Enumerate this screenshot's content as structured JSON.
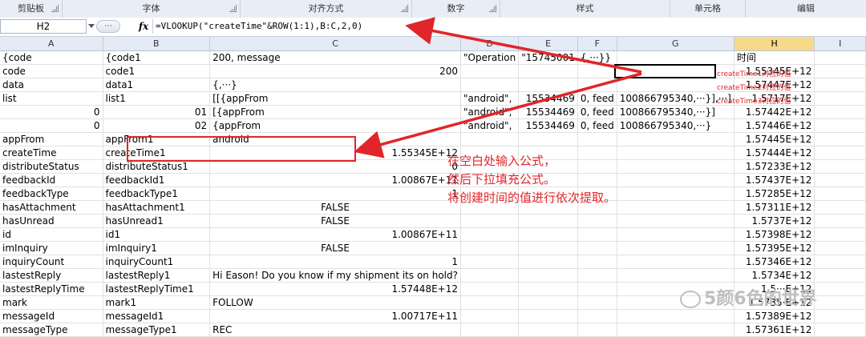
{
  "ribbon": {
    "groups": [
      "剪贴板",
      "字体",
      "对齐方式",
      "数字",
      "样式",
      "单元格",
      "编辑"
    ]
  },
  "formula_bar": {
    "name_box": "H2",
    "fx_label": "fx",
    "formula": "=VLOOKUP(\"createTime\"&ROW(1:1),B:C,2,0)"
  },
  "columns": [
    "A",
    "B",
    "C",
    "D",
    "E",
    "F",
    "G",
    "H",
    "I"
  ],
  "selected_column": "H",
  "rows": [
    [
      "{code",
      "{code1",
      "200, message",
      "\"Operation",
      "\"15745001",
      "{,···}}",
      "",
      "时间",
      ""
    ],
    [
      "code",
      "code1",
      "200",
      "",
      "",
      "",
      "",
      "1.55345E+12",
      ""
    ],
    [
      "data",
      "data1",
      "{,···}",
      "",
      "",
      "",
      "",
      "1.57447E+12",
      ""
    ],
    [
      "list",
      "list1",
      "[[{appFrom",
      "\"android\",",
      "15534469",
      "0, feed",
      "100866795340,···}],···]",
      "1.5717E+12",
      ""
    ],
    [
      "0",
      "01",
      "[{appFrom",
      "\"android\",",
      "15534469",
      "0, feed",
      "100866795340,···}]",
      "1.57442E+12",
      ""
    ],
    [
      "0",
      "02",
      "{appFrom",
      "\"android\",",
      "15534469",
      "0, feed",
      "100866795340,···}",
      "1.57446E+12",
      ""
    ],
    [
      "appFrom",
      "appFrom1",
      "android",
      "",
      "",
      "",
      "",
      "1.57445E+12",
      ""
    ],
    [
      "createTime",
      "createTime1",
      "1.55345E+12",
      "",
      "",
      "",
      "",
      "1.57444E+12",
      ""
    ],
    [
      "distributeStatus",
      "distributeStatus1",
      "0",
      "",
      "",
      "",
      "",
      "1.57233E+12",
      ""
    ],
    [
      "feedbackId",
      "feedbackId1",
      "1.00867E+11",
      "",
      "",
      "",
      "",
      "1.57437E+12",
      ""
    ],
    [
      "feedbackType",
      "feedbackType1",
      "1",
      "",
      "",
      "",
      "",
      "1.57285E+12",
      ""
    ],
    [
      "hasAttachment",
      "hasAttachment1",
      "FALSE",
      "",
      "",
      "",
      "",
      "1.57311E+12",
      ""
    ],
    [
      "hasUnread",
      "hasUnread1",
      "FALSE",
      "",
      "",
      "",
      "",
      "1.5737E+12",
      ""
    ],
    [
      "id",
      "id1",
      "1.00867E+11",
      "",
      "",
      "",
      "",
      "1.57398E+12",
      ""
    ],
    [
      "imInquiry",
      "imInquiry1",
      "FALSE",
      "",
      "",
      "",
      "",
      "1.57395E+12",
      ""
    ],
    [
      "inquiryCount",
      "inquiryCount1",
      "1",
      "",
      "",
      "",
      "",
      "1.57346E+12",
      ""
    ],
    [
      "lastestReply",
      "lastestReply1",
      "Hi Eason! Do you know if my shipment its on hold?",
      "",
      "",
      "",
      "",
      "1.5734E+12",
      ""
    ],
    [
      "lastestReplyTime",
      "lastestReplyTime1",
      "1.57448E+12",
      "",
      "",
      "",
      "",
      "1.5···E+12",
      ""
    ],
    [
      "mark",
      "mark1",
      "FOLLOW",
      "",
      "",
      "",
      "",
      "1.5735·E+12",
      ""
    ],
    [
      "messageId",
      "messageId1",
      "1.00717E+11",
      "",
      "",
      "",
      "",
      "1.57389E+12",
      ""
    ],
    [
      "messageType",
      "messageType1",
      "REC",
      "",
      "",
      "",
      "",
      "1.57361E+12",
      ""
    ]
  ],
  "annotations": {
    "notes": [
      "createTime1对应的值",
      "createTime2对应的值",
      "createTime3对应的值"
    ],
    "instructions": [
      "在空白处输入公式，",
      "然后下拉填充公式。",
      "将创建时间的值进行依次提取。"
    ],
    "accent_color": "#e0262a"
  },
  "watermark": "5颜6色的世界"
}
